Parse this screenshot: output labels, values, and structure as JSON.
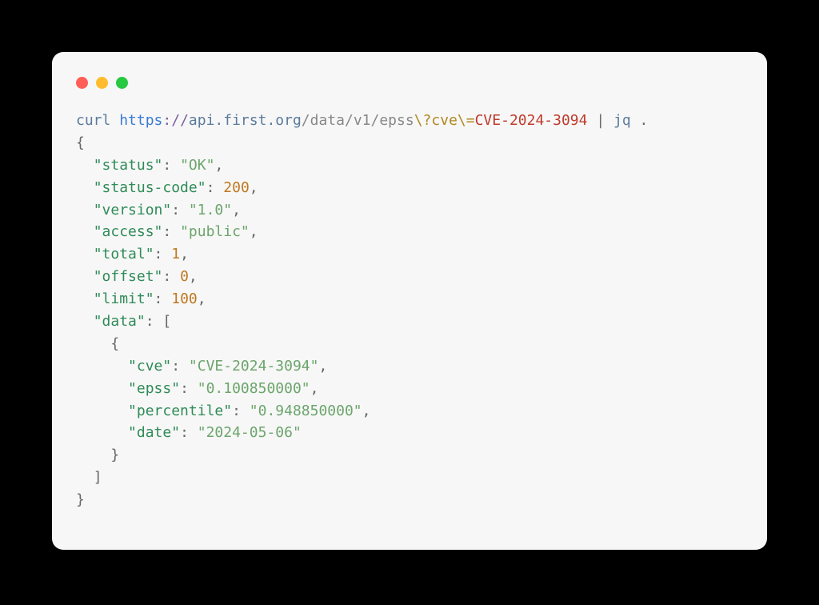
{
  "command": {
    "curl": "curl",
    "scheme": "https",
    "schemesep": "://",
    "host": "api.first.org",
    "path1": "/data/v1/",
    "path2": "epss",
    "esc1": "\\?",
    "param": "cve",
    "esc2": "\\=",
    "arg": "CVE-2024-3094",
    "pipe": " | ",
    "jq": "jq",
    "jqarg": " ."
  },
  "json": {
    "status_key": "\"status\"",
    "status_val": "\"OK\"",
    "statuscode_key": "\"status-code\"",
    "statuscode_val": "200",
    "version_key": "\"version\"",
    "version_val": "\"1.0\"",
    "access_key": "\"access\"",
    "access_val": "\"public\"",
    "total_key": "\"total\"",
    "total_val": "1",
    "offset_key": "\"offset\"",
    "offset_val": "0",
    "limit_key": "\"limit\"",
    "limit_val": "100",
    "data_key": "\"data\"",
    "cve_key": "\"cve\"",
    "cve_val": "\"CVE-2024-3094\"",
    "epss_key": "\"epss\"",
    "epss_val": "\"0.100850000\"",
    "percentile_key": "\"percentile\"",
    "percentile_val": "\"0.948850000\"",
    "date_key": "\"date\"",
    "date_val": "\"2024-05-06\""
  }
}
